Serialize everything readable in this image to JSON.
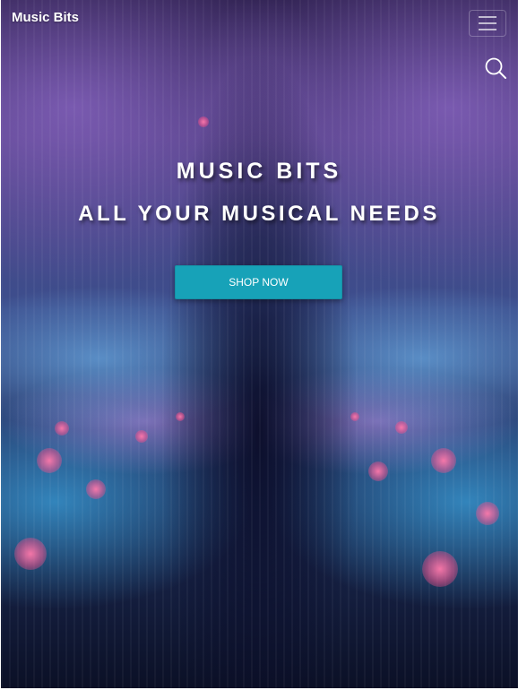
{
  "navbar": {
    "brand": "Music Bits",
    "toggler_icon": "hamburger-menu-icon",
    "search_icon": "search-icon"
  },
  "hero": {
    "title": "MUSIC BITS",
    "subtitle": "ALL YOUR MUSICAL NEEDS",
    "cta_label": "SHOP NOW"
  },
  "colors": {
    "cta_background": "#17a2b8",
    "text": "#ffffff"
  }
}
